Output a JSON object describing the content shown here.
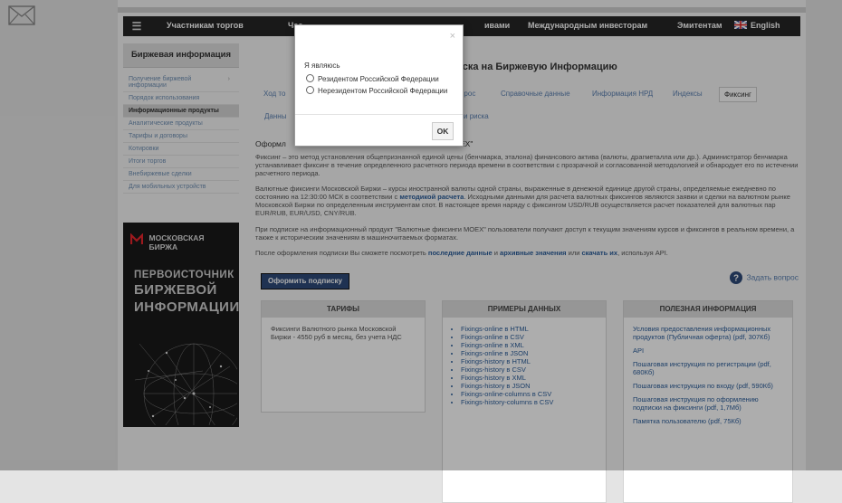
{
  "nav": {
    "items": [
      "Участникам торгов",
      "Час",
      "ивами",
      "Международным инвесторам",
      "Эмитентам"
    ],
    "english": "English"
  },
  "sidebar": {
    "heading": "Биржевая информация",
    "items": [
      {
        "label": "Получение биржевой информации"
      },
      {
        "label": "Порядок использования"
      },
      {
        "label": "Информационные продукты"
      },
      {
        "label": "Аналитические продукты"
      },
      {
        "label": "Тарифы и договоры"
      },
      {
        "label": "Котировки"
      },
      {
        "label": "Итоги торгов"
      },
      {
        "label": "Внебиржевые сделки"
      },
      {
        "label": "Для мобильных устройств"
      }
    ]
  },
  "banner": {
    "logo_line1": "МОСКОВСКАЯ",
    "logo_line2": "БИРЖА",
    "line1": "ПЕРВОИСТОЧНИК",
    "line2": "БИРЖЕВОЙ",
    "line3": "ИНФОРМАЦИИ"
  },
  "main": {
    "title_fragment": "иска на Биржевую Информацию",
    "tabs": [
      "Ход то",
      "т на запрос",
      "Справочные данные",
      "Информация НРД",
      "Индексы",
      "Фиксинг"
    ],
    "tabs_row2_left": "Данны",
    "tabs_row2_right": "и риска",
    "heading_left": "Оформл",
    "heading_right": "EX\"",
    "para1": "Фиксинг – это метод установления общепризнанной единой цены (бенчмарка, эталона) финансового актива (валюты, драгметалла или др.). Администратор бенчмарка устанавливает фиксинг в течение определенного расчетного периода времени в соответствии с прозрачной и согласованной методологией и обнародует его по истечении расчетного периода.",
    "para2_a": "Валютные фиксинги Московской Биржи – курсы иностранной валюты одной страны, выраженные в денежной единице другой страны, определяемые ежедневно по состоянию на 12:30:00 МСК в соответствии с ",
    "para2_link": "методикой расчета",
    "para2_b": ". Исходными данными для расчета валютных фиксингов являются заявки и сделки на валютном рынке Московской Биржи по определенным инструментам спот. В настоящее время наряду с фиксингом USD/RUB осуществляется расчет показателей для валютных пар EUR/RUB, EUR/USD, CNY/RUB.",
    "para3": "При подписке на информационный продукт \"Валютные фиксинги MOEX\" пользователи получают доступ к текущим значениям курсов и фиксингов в реальном времени, а также к историческим значениям в машиночитаемых форматах.",
    "para4_a": "После оформления подписки Вы сможете посмотреть ",
    "para4_link1": "последние данные",
    "para4_and": " и ",
    "para4_link2": "архивные значения",
    "para4_or": " или ",
    "para4_link3": "скачать их",
    "para4_b": ", используя API.",
    "cta_label": "Оформить подписку",
    "ask_label": "Задать вопрос"
  },
  "boxes": {
    "tariffs": {
      "heading": "ТАРИФЫ",
      "text": "Фиксинги Валютного рынка Московской Биржи - 4550 руб в месяц, без учета НДС"
    },
    "examples": {
      "heading": "ПРИМЕРЫ ДАННЫХ",
      "links": [
        "Fixings-online в HTML",
        "Fixings-online в CSV",
        "Fixings-online в XML",
        "Fixings-online в JSON",
        "Fixings-history в HTML",
        "Fixings-history в CSV",
        "Fixings-history в XML",
        "Fixings-history в JSON",
        "Fixings-online-columns в CSV",
        "Fixings-history-columns в CSV"
      ]
    },
    "useful": {
      "heading": "ПОЛЕЗНАЯ ИНФОРМАЦИЯ",
      "links": [
        "Условия предоставления информационных продуктов (Публичная оферта) (pdf, 307Кб)",
        "API",
        "Пошаговая инструкция по регистрации (pdf, 680Кб)",
        "Пошаговая инструкция по входу (pdf, 590Кб)",
        "Пошаговая инструкция по оформлению подписки на фиксинги (pdf, 1,7Мб)",
        "Памятка пользователю (pdf, 75Кб)"
      ]
    }
  },
  "modal": {
    "close": "×",
    "label": "Я являюсь",
    "option1": "Резидентом Российской Федерации",
    "option2": "Нерезидентом Российской Федерации",
    "ok_label": "OK"
  }
}
